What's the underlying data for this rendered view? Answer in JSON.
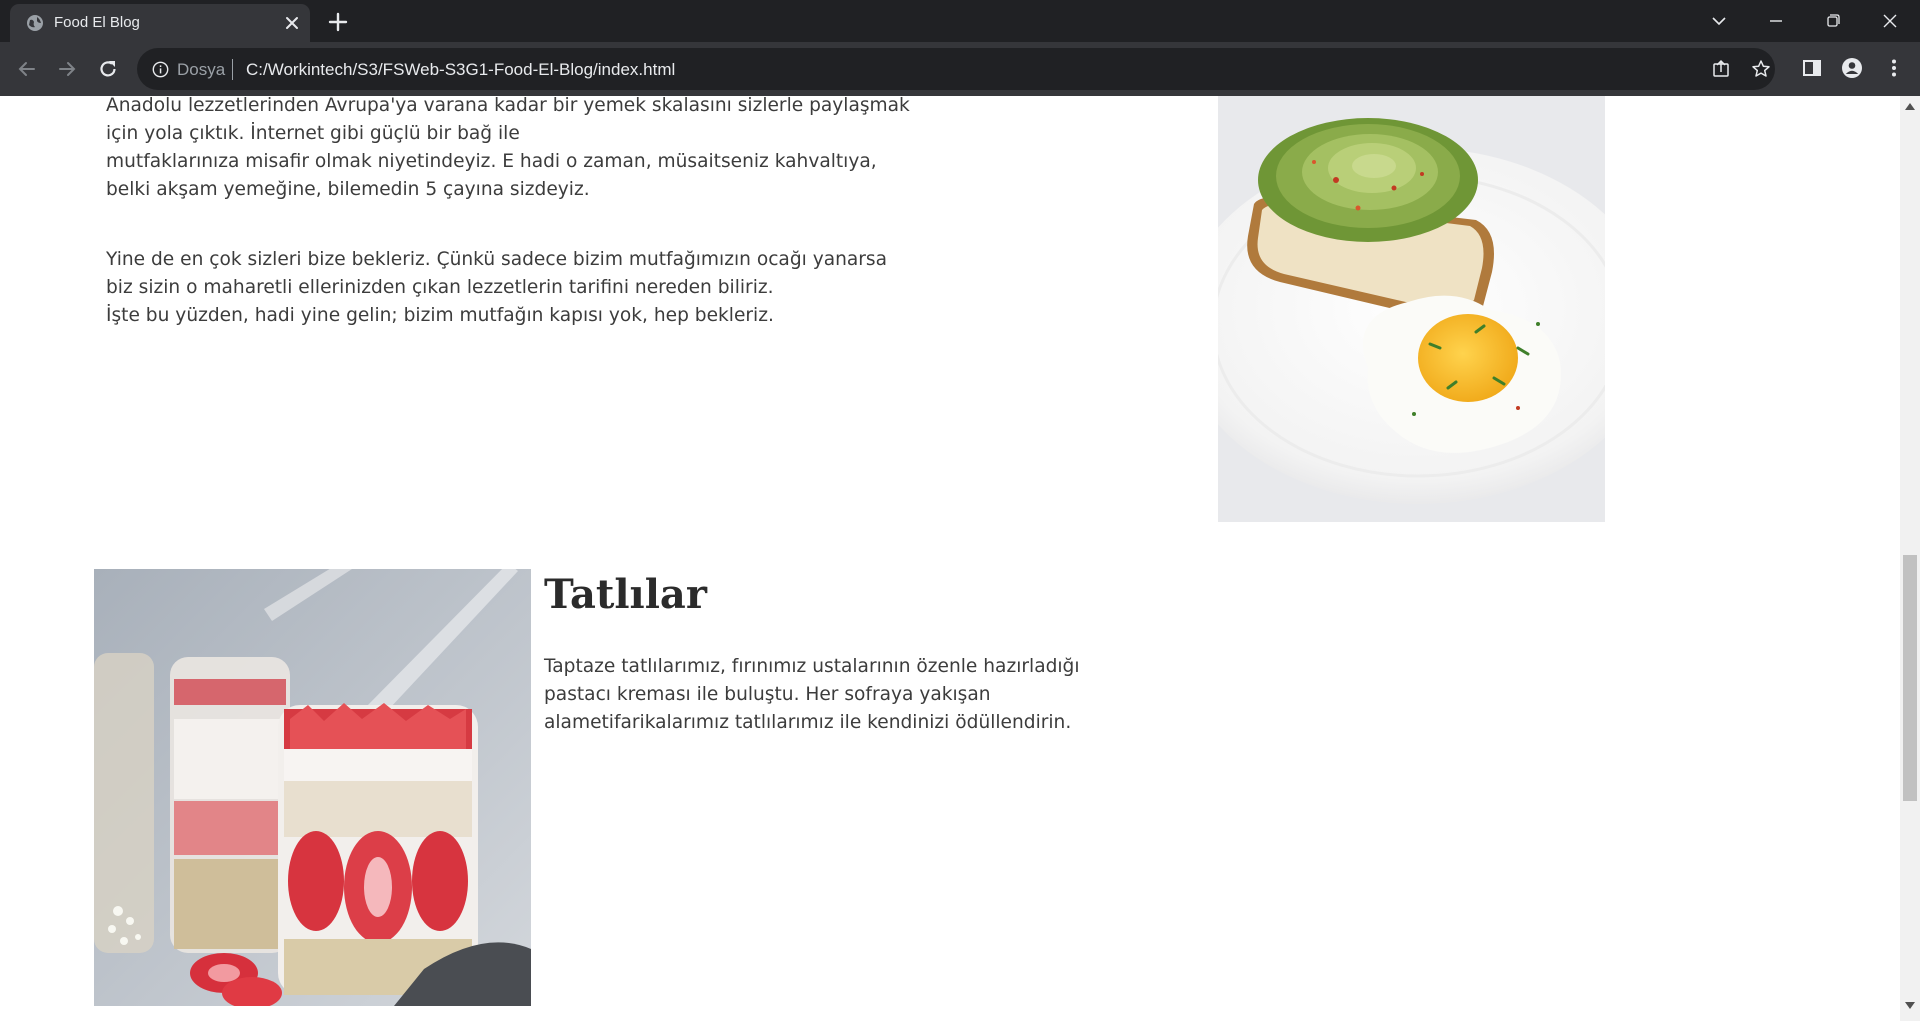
{
  "browser": {
    "tab": {
      "title": "Food El Blog"
    },
    "address": {
      "scheme_label": "Dosya",
      "url": "C:/Workintech/S3/FSWeb-S3G1-Food-El-Blog/index.html"
    },
    "icons": {
      "favicon": "globe-icon",
      "close_tab": "close-icon",
      "new_tab": "plus-icon",
      "back": "arrow-left-icon",
      "forward": "arrow-right-icon",
      "reload": "reload-icon",
      "info": "info-icon",
      "share": "share-icon",
      "bookmark": "star-icon",
      "side_panel": "side-panel-icon",
      "profile": "profile-icon",
      "menu": "kebab-menu-icon"
    },
    "colors": {
      "tabbar": "#202124",
      "toolbar": "#35363a",
      "omnibox": "#202124",
      "text": "#e8eaed"
    }
  },
  "page": {
    "intro": {
      "paragraph_1_lines": [
        "Anadolu lezzetlerinden Avrupa'ya varana kadar bir yemek skalasını sizlerle paylaşmak",
        "için yola çıktık. İnternet gibi güçlü bir bağ ile",
        "mutfaklarınıza misafir olmak niyetindeyiz. E hadi o zaman, müsaitseniz kahvaltıya,",
        "belki akşam yemeğine, bilemedin 5 çayına sizdeyiz."
      ],
      "paragraph_2_lines": [
        "Yine de en çok sizleri bize bekleriz. Çünkü sadece bizim mutfağımızın ocağı yanarsa",
        "biz sizin o maharetli ellerinizden çıkan lezzetlerin tarifini nereden biliriz.",
        "İşte bu yüzden, hadi yine gelin; bizim mutfağın kapısı yok, hep bekleriz."
      ]
    },
    "breakfast_image": {
      "subject": "avocado toast with fried egg on a white plate"
    },
    "desserts": {
      "title": "Tatlılar",
      "text_lines": [
        "Taptaze tatlılarımız, fırınımız ustalarının özenle hazırladığı",
        "pastacı kreması ile buluştu. Her sofraya yakışan",
        "alametifarikalarımız tatlılarımız ile kendinizi ödüllendirin."
      ],
      "image": {
        "subject": "jars of yogurt parfait with oats and strawberries"
      }
    }
  }
}
